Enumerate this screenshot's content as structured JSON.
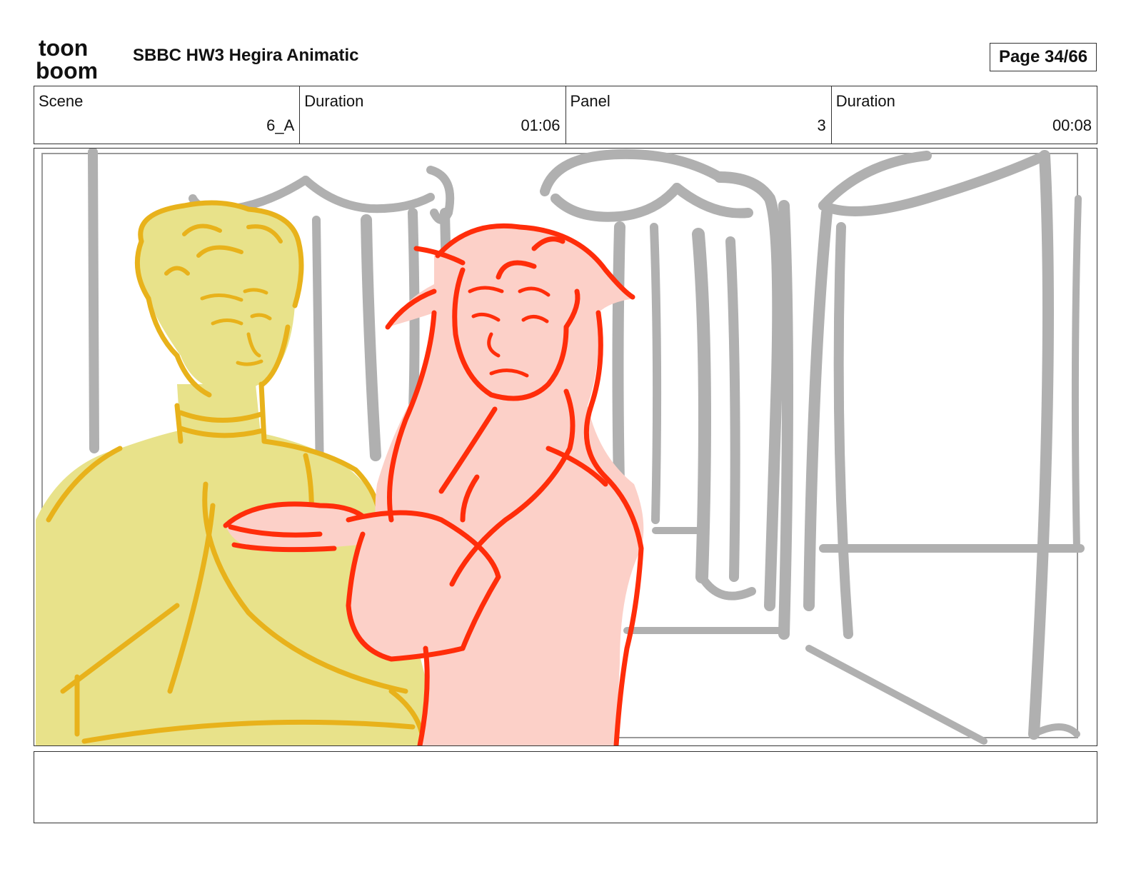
{
  "header": {
    "logo_line1": "toon",
    "logo_line2": "boom",
    "project_title": "SBBC HW3 Hegira Animatic",
    "page_label": "Page 34/66"
  },
  "info": {
    "scene_label": "Scene",
    "scene_value": "6_A",
    "scene_duration_label": "Duration",
    "scene_duration_value": "01:06",
    "panel_label": "Panel",
    "panel_value": "3",
    "panel_duration_label": "Duration",
    "panel_duration_value": "00:08"
  },
  "panel": {
    "colors": {
      "background_lines": "#b0b0b0",
      "yellow_fill": "#e8e28a",
      "yellow_line": "#e8b21b",
      "pink_fill": "#fcd0c8",
      "red_line": "#ff2d0a"
    }
  },
  "notes": {
    "text": ""
  }
}
